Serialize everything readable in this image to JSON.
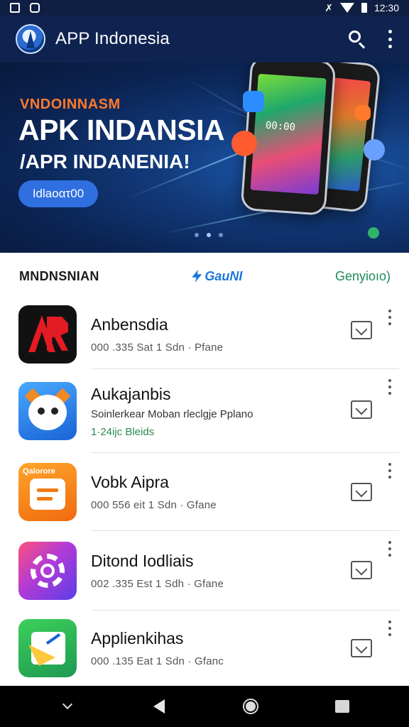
{
  "status_bar": {
    "time": "12:30"
  },
  "app_bar": {
    "title": "APP Indonesia"
  },
  "banner": {
    "kicker": "VNDOINNASM",
    "title": "APK INDANSIA",
    "subtitle": "/APR INDANENIA!",
    "button_label": "Idlaoατ00",
    "phone_clock": "00:00",
    "carousel_pages": 3,
    "carousel_active": 2
  },
  "tabs": [
    {
      "label": "MNDNSNIAN"
    },
    {
      "label": "GauNI"
    },
    {
      "label": "Genyioıo)"
    }
  ],
  "apps": [
    {
      "name": "Anbensdia",
      "meta": "000 .335 Sat 1 Sdn · Pfane",
      "icon": "ar-logo-icon"
    },
    {
      "name": "Aukajanbis",
      "desc": "Soinlerkear Moban rleclgje Pplano",
      "status": "1·24ĳc Bleids",
      "icon": "cartoon-face-icon"
    },
    {
      "name": "Vobk Aipra",
      "meta": "000 556 eit 1 Sdn · Gfane",
      "icon": "document-icon",
      "icon_text": "Qalorore"
    },
    {
      "name": "Ditond Iodliais",
      "meta": "002 .335 Est 1 Sdh · Gfane",
      "icon": "gear-icon"
    },
    {
      "name": "Applienkihas",
      "meta": "000 .135 Eat 1 Sdn · Gfanc",
      "icon": "chart-icon"
    }
  ],
  "colors": {
    "app_bar": "#0f2350",
    "accent_blue": "#2f6fe0",
    "accent_orange": "#ff7a2a",
    "status_green": "#2a8a4f"
  }
}
